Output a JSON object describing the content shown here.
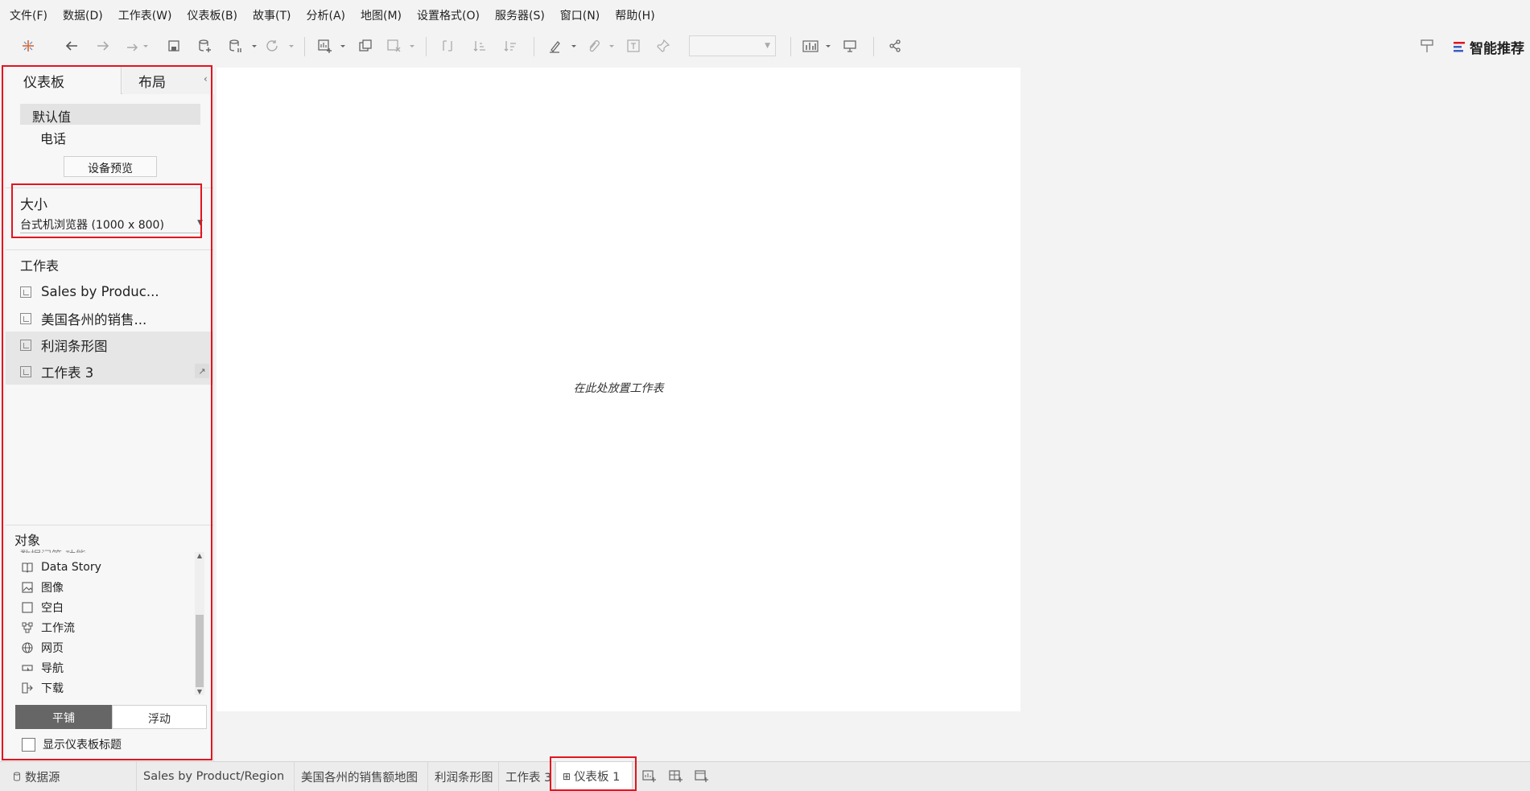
{
  "menu": [
    "文件(F)",
    "数据(D)",
    "工作表(W)",
    "仪表板(B)",
    "故事(T)",
    "分析(A)",
    "地图(M)",
    "设置格式(O)",
    "服务器(S)",
    "窗口(N)",
    "帮助(H)"
  ],
  "toolbar": {
    "smart_recommend": "智能推荐",
    "icons": [
      "tableau-logo-icon",
      "undo-icon",
      "redo-icon",
      "forward-icon",
      "save-icon",
      "new-datasource-icon",
      "pause-updates-icon",
      "refresh-icon",
      "new-worksheet-icon",
      "duplicate-icon",
      "clear-icon",
      "swap-icon",
      "sort-ascending-icon",
      "sort-descending-icon",
      "highlight-icon",
      "attach-icon",
      "label-icon",
      "pin-icon",
      "fit-select",
      "show-me-icon",
      "presentation-icon",
      "share-icon"
    ]
  },
  "left_panel": {
    "tabs": [
      "仪表板",
      "布局"
    ],
    "devices": {
      "default": "默认值",
      "phone": "电话",
      "preview_button": "设备预览"
    },
    "size": {
      "label": "大小",
      "value": "台式机浏览器 (1000 x 800)"
    },
    "sheets": {
      "label": "工作表",
      "items": [
        {
          "name": "Sales by Produc...",
          "used": false
        },
        {
          "name": "美国各州的销售...",
          "used": false
        },
        {
          "name": "利润条形图",
          "used": true
        },
        {
          "name": "工作表 3",
          "used": true
        }
      ]
    },
    "objects": {
      "label": "对象",
      "partial_item": "数据问答 功能",
      "items": [
        {
          "label": "Data Story",
          "icon": "book-icon"
        },
        {
          "label": "图像",
          "icon": "image-icon"
        },
        {
          "label": "空白",
          "icon": "blank-icon"
        },
        {
          "label": "工作流",
          "icon": "workflow-icon"
        },
        {
          "label": "网页",
          "icon": "globe-icon"
        },
        {
          "label": "导航",
          "icon": "navigation-icon"
        },
        {
          "label": "下载",
          "icon": "download-icon"
        }
      ]
    },
    "layout_mode": {
      "tiled": "平铺",
      "floating": "浮动",
      "selected": "平铺"
    },
    "show_title": {
      "label": "显示仪表板标题",
      "checked": false
    }
  },
  "canvas": {
    "drop_hint": "在此处放置工作表"
  },
  "bottom_tabs": {
    "datasource": "数据源",
    "sheets": [
      "Sales by Product/Region",
      "美国各州的销售额地图",
      "利润条形图",
      "工作表 3",
      "仪表板 1"
    ],
    "active": "仪表板 1"
  },
  "colors": {
    "highlight": "#e3141f",
    "active_segment": "#666666"
  }
}
